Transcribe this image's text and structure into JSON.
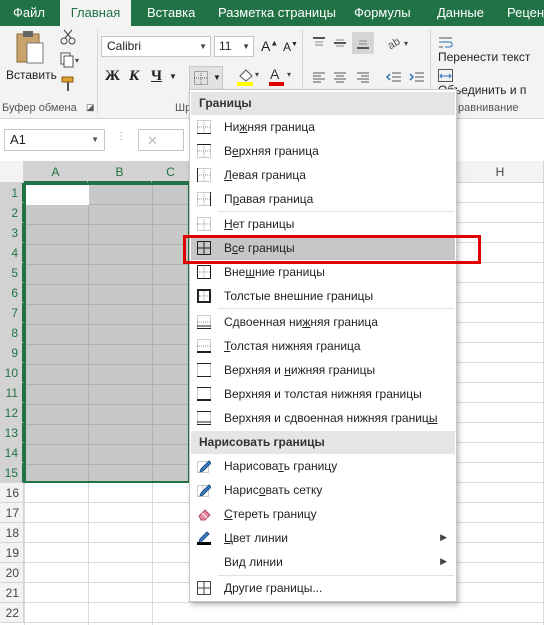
{
  "ribbon_tabs": [
    "Файл",
    "Главная",
    "Вставка",
    "Разметка страницы",
    "Формулы",
    "Данные",
    "Реценз"
  ],
  "ribbon": {
    "paste_label": "Вставить",
    "clipboard_group": "Буфер обмена",
    "font_group": "Шр",
    "font_name": "Calibri",
    "font_size": "11",
    "grow_font": "A",
    "shrink_font": "A",
    "bold": "Ж",
    "italic": "К",
    "underline": "Ч",
    "wrap_text": "Перенести текст",
    "merge_center": "Объединить и п",
    "alignment_group": "равнивание"
  },
  "formula_bar": {
    "name_box": "A1"
  },
  "grid": {
    "columns": [
      "A",
      "B",
      "C",
      "H"
    ],
    "rows": [
      "1",
      "2",
      "3",
      "4",
      "5",
      "6",
      "7",
      "8",
      "9",
      "10",
      "11",
      "12",
      "13",
      "14",
      "15",
      "16",
      "17",
      "18",
      "19",
      "20",
      "21",
      "22"
    ]
  },
  "menu": {
    "section_borders": "Границы",
    "items_a": [
      {
        "pre": "Ни",
        "u": "ж",
        "post": "няя граница",
        "icon": "bottom-border-icon"
      },
      {
        "pre": "В",
        "u": "е",
        "post": "рхняя граница",
        "icon": "top-border-icon"
      },
      {
        "pre": "",
        "u": "Л",
        "post": "евая граница",
        "icon": "left-border-icon"
      },
      {
        "pre": "П",
        "u": "р",
        "post": "авая граница",
        "icon": "right-border-icon"
      }
    ],
    "no_border": {
      "pre": "",
      "u": "Н",
      "post": "ет границы"
    },
    "all_borders": {
      "pre": "В",
      "u": "с",
      "post": "е границы"
    },
    "outside_borders": {
      "pre": "Вне",
      "u": "ш",
      "post": "ние границы"
    },
    "thick_outside": {
      "pre": "Толстые внешние границы",
      "u": "",
      "post": ""
    },
    "items_b": [
      {
        "pre": "Сдвоенная ни",
        "u": "ж",
        "post": "няя граница"
      },
      {
        "pre": "",
        "u": "Т",
        "post": "олстая нижняя граница"
      },
      {
        "pre": "Верхняя и ",
        "u": "н",
        "post": "ижняя границы"
      },
      {
        "pre": "Верхняя и толстая нижняя границы",
        "u": "",
        "post": ""
      },
      {
        "pre": "Верхняя и сдвоенная нижняя границ",
        "u": "ы",
        "post": ""
      }
    ],
    "section_draw": "Нарисовать границы",
    "draw_items": [
      {
        "pre": "Нарисова",
        "u": "т",
        "post": "ь границу"
      },
      {
        "pre": "Нарис",
        "u": "о",
        "post": "вать сетку"
      },
      {
        "pre": "",
        "u": "С",
        "post": "тереть границу"
      },
      {
        "pre": "",
        "u": "Ц",
        "post": "вет линии"
      },
      {
        "pre": "Ви",
        "u": "д",
        "post": " линии"
      }
    ],
    "more_borders": {
      "pre": "",
      "u": "Д",
      "post": "ругие границы..."
    }
  },
  "colors": {
    "accent": "#217346",
    "highlight_box": "#e00000",
    "selection_fill": "#c8c8c8",
    "font_color_bar": "#e00000",
    "fill_color_bar": "#ffff00"
  }
}
